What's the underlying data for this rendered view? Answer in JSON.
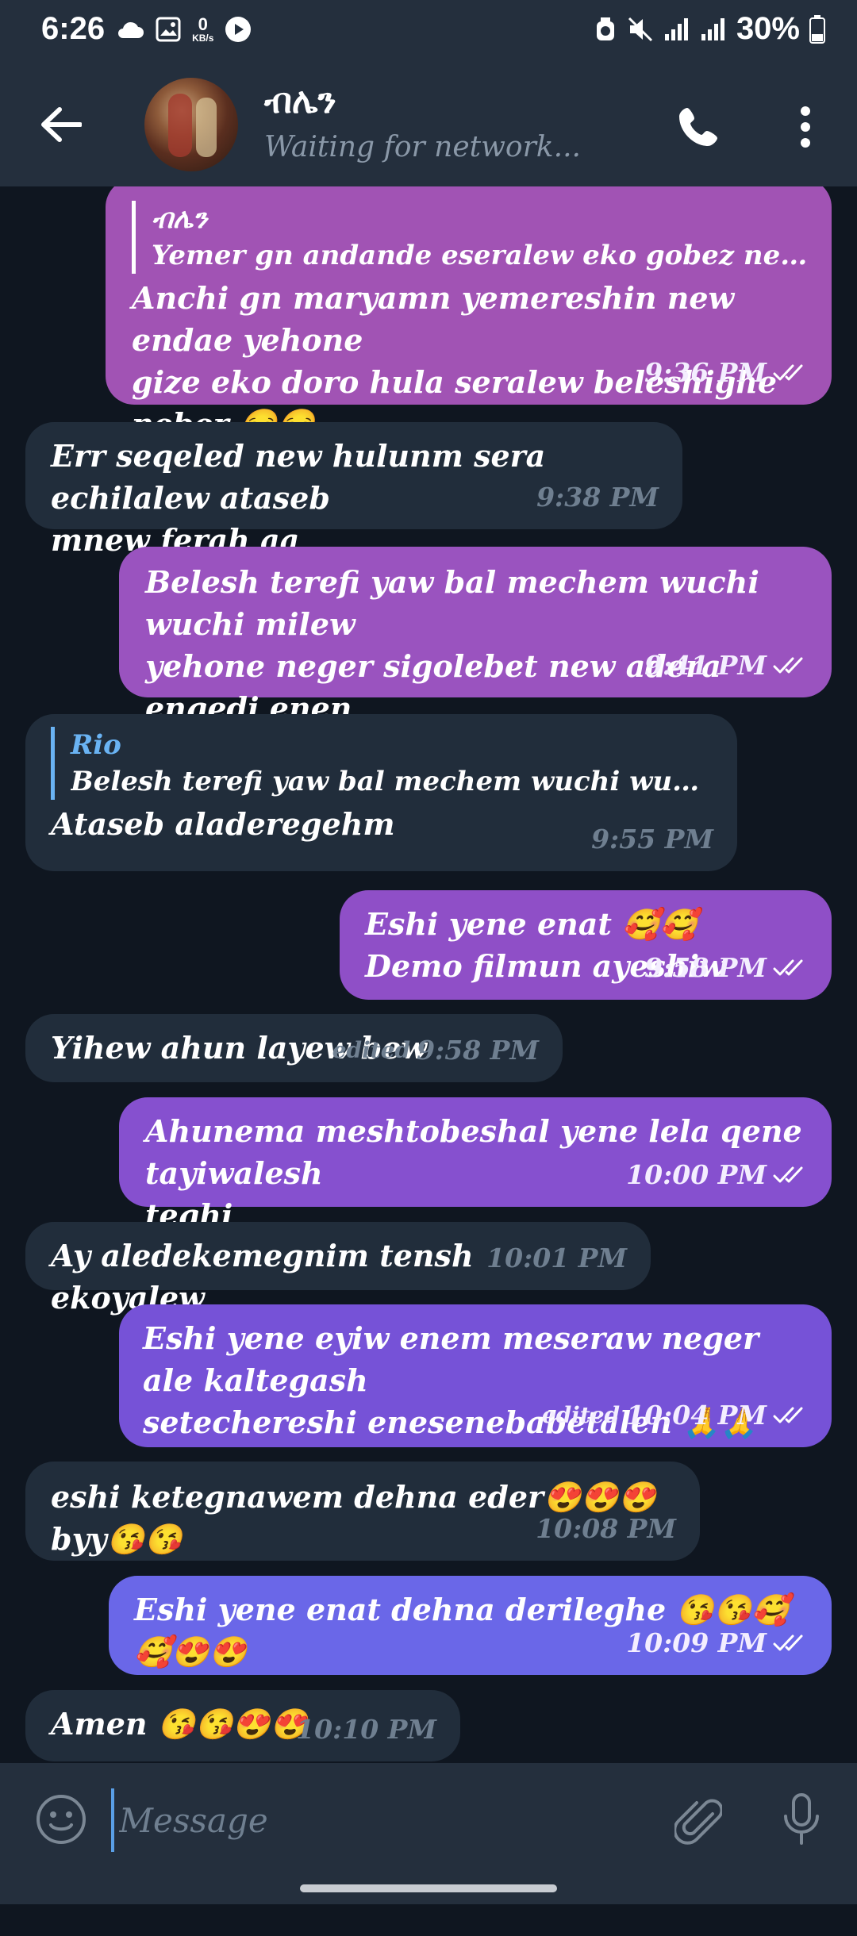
{
  "status_bar": {
    "time": "6:26",
    "net_speed_value": "0",
    "net_speed_unit": "KB/s",
    "battery": "30%"
  },
  "header": {
    "title": "ብሌን",
    "status": "Waiting for network..."
  },
  "colors": {
    "incoming": "#212d3b",
    "outgoing_top": "#a055b8",
    "outgoing_bottom": "#6b6be8"
  },
  "messages": [
    {
      "direction": "out",
      "reply_name": "ብሌን",
      "reply_text": "Yemer gn andande eseralew eko gobez negni yemiserut...",
      "text": "Anchi gn maryamn yemereshin new endae yehone\ngize eko doro hula seralew beleshighe neber 😒😒",
      "edited": "",
      "time": "9:36 PM",
      "status_icon": "double-check-icon"
    },
    {
      "direction": "in",
      "reply_name": "",
      "reply_text": "",
      "text": "Err seqeled new hulunm sera echilalew ataseb\nmnew ferah aa",
      "edited": "",
      "time": "9:38 PM"
    },
    {
      "direction": "out",
      "reply_name": "",
      "reply_text": "",
      "text": "Belesh terefi yaw bal mechem wuchi wuchi milew\nyehone neger sigolebet new adera engedi enen\nmetfo sew atargighe",
      "edited": "",
      "time": "9:41 PM",
      "status_icon": "double-check-icon"
    },
    {
      "direction": "in",
      "reply_name": "Rio",
      "reply_text": "Belesh terefi yaw bal mechem wuchi wuchi milew yeh...",
      "text": "Ataseb aladeregehm",
      "edited": "",
      "time": "9:55 PM"
    },
    {
      "direction": "out",
      "reply_name": "",
      "reply_text": "",
      "text": "Eshi yene enat 🥰🥰\nDemo filmun ayeshiw",
      "edited": "",
      "time": "9:58 PM",
      "status_icon": "double-check-icon"
    },
    {
      "direction": "in",
      "reply_name": "",
      "reply_text": "",
      "text": "Yihew ahun layew bew",
      "edited": "edited",
      "time": "9:58 PM"
    },
    {
      "direction": "out",
      "reply_name": "",
      "reply_text": "",
      "text": "Ahunema meshtobeshal yene lela qene tayiwalesh\nteghi",
      "edited": "",
      "time": "10:00 PM",
      "status_icon": "double-check-icon"
    },
    {
      "direction": "in",
      "reply_name": "",
      "reply_text": "",
      "text": "Ay aledekemegnim tensh ekoyalew",
      "edited": "",
      "time": "10:01 PM"
    },
    {
      "direction": "out",
      "reply_name": "",
      "reply_text": "",
      "text": "Eshi yene eyiw enem meseraw neger ale kaltegash\nsetechereshi enesenebabetalen 🙏🙏",
      "edited": "edited",
      "time": "10:04 PM",
      "status_icon": "double-check-icon"
    },
    {
      "direction": "in",
      "reply_name": "",
      "reply_text": "",
      "text": "eshi ketegnawem dehna eder😍😍😍byy😘😘",
      "edited": "",
      "time": "10:08 PM"
    },
    {
      "direction": "out",
      "reply_name": "",
      "reply_text": "",
      "text": "Eshi yene enat dehna derileghe 😘😘🥰🥰😍😍",
      "edited": "",
      "time": "10:09 PM",
      "status_icon": "double-check-icon"
    },
    {
      "direction": "in",
      "reply_name": "",
      "reply_text": "",
      "text": "Amen 😘😘😍😍",
      "edited": "",
      "time": "10:10 PM"
    }
  ],
  "composer": {
    "placeholder": "Message"
  }
}
